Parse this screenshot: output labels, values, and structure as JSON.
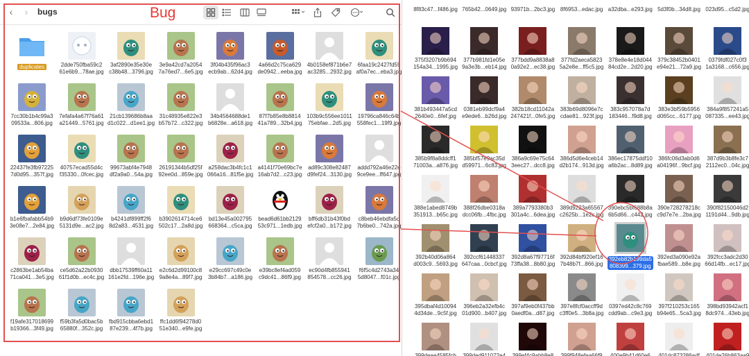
{
  "toolbar": {
    "back_icon": "chevron-left-icon",
    "forward_icon": "chevron-right-icon",
    "folder_title": "bugs",
    "annotation": "Bug"
  },
  "left_items": [
    {
      "name": "duplicates",
      "kind": "folder"
    },
    {
      "name": "2dde750fba59c2\n61e6b9...78ae.jpg",
      "kind": "ghost"
    },
    {
      "name": "3af2890e35e30e\nc38b48...3796.jpg",
      "kind": "teal"
    },
    {
      "name": "3e9a42cd7a2054\n7a76ed7...6e5.jpg",
      "kind": "green"
    },
    {
      "name": "3f04b435f96ac3\necb9ab...62d4.jpg",
      "kind": "purple"
    },
    {
      "name": "4a66d2c75ca629\nde0942...eeba.jpg",
      "kind": "purple2"
    },
    {
      "name": "4b0158ef871b6e7\nac3285...2932.jpg",
      "kind": "person"
    },
    {
      "name": "6faa19c2427fd59\naf0a7ec...eba3.jpg",
      "kind": "teal"
    },
    {
      "name": "7cc30b1b4c99a3\n09533a...806.jpg",
      "kind": "teal2"
    },
    {
      "name": "7efafa4a67f76a61\na21449...5761.jpg",
      "kind": "green"
    },
    {
      "name": "21cb139686b8aa\nd1c022...d1ee1.jpg",
      "kind": "teal3"
    },
    {
      "name": "31c48935e822e3\nb57b72...c322.jpg",
      "kind": "green"
    },
    {
      "name": "34b4564688de1\nb6828e...a618.jpg",
      "kind": "person"
    },
    {
      "name": "87f7b85e8b8814\n41a789...32b4.jpg",
      "kind": "green"
    },
    {
      "name": "103b9c556ee1011\n75ebfae...2d5.jpg",
      "kind": "teal"
    },
    {
      "name": "19796ca846c64b\n558fec1...19f9.jpg",
      "kind": "purple"
    },
    {
      "name": "22437fe3fb97225\n7d0d95...357f.jpg",
      "kind": "orange"
    },
    {
      "name": "40757ecad55d4c\nf35330...0fcec.jpg",
      "kind": "teal"
    },
    {
      "name": "99673abf4e7948\ndf2a9a0...54a.jpg",
      "kind": "green"
    },
    {
      "name": "26191344b5df25f\n92ee0d...859e.jpg",
      "kind": "green"
    },
    {
      "name": "a258dac3b4fc1c1\n066a16...81f5e.jpg",
      "kind": "magenta"
    },
    {
      "name": "a4141f70e69bc7e\n16ab7d2...c23.jpg",
      "kind": "green"
    },
    {
      "name": "ad89c308e82487\nd9fef24...3130.jpg",
      "kind": "purple"
    },
    {
      "name": "addd792a46e22e\n9ce9ee...ff647.jpg",
      "kind": "person"
    },
    {
      "name": "b1e6fbafabb54b9\n3e08e7...2e84.jpg",
      "kind": "orange"
    },
    {
      "name": "b9d6df73fe0109e\n5131d9e...ac2.jpg",
      "kind": "orange2"
    },
    {
      "name": "b4241df899ff2f6\n8d2a83...4531.jpg",
      "kind": "teal3"
    },
    {
      "name": "b3902614714ce6\n502c17...2a8d.jpg",
      "kind": "teal"
    },
    {
      "name": "bd13e45a002795\n668364...c5ca.jpg",
      "kind": "magenta"
    },
    {
      "name": "bead6d61bb2129\n53c971...1edb.jpg",
      "kind": "penguin"
    },
    {
      "name": "bff6db31b43f0bd\nefcf2a0...b172.jpg",
      "kind": "magenta"
    },
    {
      "name": "c8beb46ebdfa5d\n7b6be0...742a.jpg",
      "kind": "purple"
    },
    {
      "name": "c2863be1ab54ba\n71ca041...3e5.jpg",
      "kind": "magenta"
    },
    {
      "name": "ce5d62a22b0930\n61f1d0b...ec4c.jpg",
      "kind": "green"
    },
    {
      "name": "dbb17539ff60a11\n161e2fd...196e.jpg",
      "kind": "person"
    },
    {
      "name": "e2c6d2d99100c8\n9a8e4a...89f7.jpg",
      "kind": "orange2"
    },
    {
      "name": "e29cc697c49c0e\n3b84b7...a186.jpg",
      "kind": "teal3"
    },
    {
      "name": "e39bc8ef4ad059\nc9dc41...86f9.jpg",
      "kind": "green"
    },
    {
      "name": "ec90d4fb855941\n854578...cc26.jpg",
      "kind": "person"
    },
    {
      "name": "f6f5c4d2743a34\n5d8047...f01c.jpg",
      "kind": "green2"
    },
    {
      "name": "f19afe317018699\nb19366...3f49.jpg",
      "kind": "green"
    },
    {
      "name": "f59b3fa5d0bac5b\n65880f...352c.jpg",
      "kind": "teal3"
    },
    {
      "name": "fbd915cbba6ebd1\n87e239...4f7b.jpg",
      "kind": "teal3"
    },
    {
      "name": "ffc1dd6f94278d0\n51e340...e9fe.jpg",
      "kind": "orange2"
    }
  ],
  "right_items": [
    {
      "name": "8f83c47...f486.jpg",
      "color": "#ffffff"
    },
    {
      "name": "765b42...0649.jpg",
      "color": "#ffffff"
    },
    {
      "name": "93971b...2bc3.jpg",
      "color": "#ffffff"
    },
    {
      "name": "8f6953...edac.jpg",
      "color": "#ffffff"
    },
    {
      "name": "a32dba...e293.jpg",
      "color": "#ffffff"
    },
    {
      "name": "5d3f0b...34d8.jpg",
      "color": "#ffffff"
    },
    {
      "name": "023d95...c5d2.jpg",
      "color": "#ffffff"
    },
    {
      "name": "375f3207b9b694\n154a34...1995.jpg",
      "color": "#2a1f4a"
    },
    {
      "name": "377b981fd1e05e\n9a3e3b...eb14.jpg",
      "color": "#3b2a2a"
    },
    {
      "name": "377bdd9a8838a8\n0a92e2...ec38.jpg",
      "color": "#7a1f1f"
    },
    {
      "name": "377fd2aeca5823\n5a2e8e...ff5c5.jpg",
      "color": "#8a7a6a"
    },
    {
      "name": "378e8e4e18d044\n84cd2e...2d20.jpg",
      "color": "#1a1a1a"
    },
    {
      "name": "379c38452b0401\ne94e21...72a9.jpg",
      "color": "#5a4a3a"
    },
    {
      "name": "0379fdf027c0f3\n1a3168...c656.jpg",
      "color": "#2a4a8a"
    },
    {
      "name": "381b493447a5cd\n2640e0...6fef.jpg",
      "color": "#6a5aaa"
    },
    {
      "name": "0381eb99dcf9a4\ne9ede6...b26d.jpg",
      "color": "#3a2a2a"
    },
    {
      "name": "382b18cd11042a\n247421f...0fe5.jpg",
      "color": "#b08a6a"
    },
    {
      "name": "383b69d8096e7c\ncdae81...923f.jpg",
      "color": "#c0b0a0"
    },
    {
      "name": "383c957078a7d\n183446...f9d8.jpg",
      "color": "#3a3030"
    },
    {
      "name": "383e3bf59b5956\nd065cc...6177.jpg",
      "color": "#5a4020"
    },
    {
      "name": "384a9f857241a5\n087335...ee43.jpg",
      "color": "#e0e0e0"
    },
    {
      "name": "385b9f8a8ddcff1\n71003a...a876.jpg",
      "color": "#2a2a2a"
    },
    {
      "name": "385bf57e9ac35d\nd59971...6c83.jpg",
      "color": "#d0c030"
    },
    {
      "name": "386a9c69e75c64\n3eec27...dcc8.jpg",
      "color": "#111111"
    },
    {
      "name": "386d5d6e4ceb14\nd2b174...913d.jpg",
      "color": "#d0a090"
    },
    {
      "name": "386ec17875ddf10\na6b2ac...8d89.jpg",
      "color": "#506070"
    },
    {
      "name": "386fc06d3ab0d6\na04196f...9bcf.jpg",
      "color": "#e8a0c0"
    },
    {
      "name": "387d9b3b8fe3c7\n2112ec0...04c.jpg",
      "color": "#8a7050"
    },
    {
      "name": "388e1abed8749b\n351913...b65c.jpg",
      "color": "#f0f0f0"
    },
    {
      "name": "388f26dbe0318a\ndcc06fb...4fbc.jpg",
      "color": "#c08070"
    },
    {
      "name": "389a7793380b3\n301a4c...6dea.jpg",
      "color": "#b03030"
    },
    {
      "name": "389d9223a65567\nc2625b...1e2c.jpg",
      "color": "#dddddd"
    },
    {
      "name": "390ebc5bf688b8a\n6b5d66...c442.jpg",
      "color": "#2a2a2a"
    },
    {
      "name": "390e728278218c\nc9d7e7e...2ba.jpg",
      "color": "#7a6050"
    },
    {
      "name": "390f82150046d2\n1191d44...9db.jpg",
      "color": "#3a3a3a"
    },
    {
      "name": "392b40d06a864\nd003c9...5693.jpg",
      "color": "#a09070"
    },
    {
      "name": "392ccf61448337\n647caa...0cbcf.jpg",
      "color": "#304050"
    },
    {
      "name": "392d8a67f97716f\n73ffa38...8b80.jpg",
      "color": "#3050a0"
    },
    {
      "name": "392d84bf920ef16\n7b48b7f...866.jpg",
      "color": "#d0b080"
    },
    {
      "name": "392eb82b199da5\n808399...379.jpg",
      "color": "#5a8a90",
      "selected": true
    },
    {
      "name": "392ed3a090e92a\nfbae589...b8e.jpg",
      "color": "#c09090"
    },
    {
      "name": "392fcc3adc2d30\n66d14fb...ec17.jpg",
      "color": "#d0c0c0"
    },
    {
      "name": "395dbaf4d10094\n4d34de...9c5f.jpg",
      "color": "#c0a080"
    },
    {
      "name": "396eb2a32efb4c\n01d900...b407.jpg",
      "color": "#d0c0b0"
    },
    {
      "name": "397af9eb0f437bb\n0aedf0a...d87.jpg",
      "color": "#7a5a40"
    },
    {
      "name": "397e8fcf0accff9d\nc3ff0e5...3b8a.jpg",
      "color": "#8a8a8a"
    },
    {
      "name": "0397ed42c8c769\ncdd9ab...c9e3.jpg",
      "color": "#f0f0f0"
    },
    {
      "name": "397f210253c165\nb94e65...5ca3.jpg",
      "color": "#d0c8c0"
    },
    {
      "name": "398bd93942acf1\n8dc974...43eb.jpg",
      "color": "#d07080"
    },
    {
      "name": "399deae4585fcb",
      "color": "#b09080"
    },
    {
      "name": "399ded911072e4",
      "color": "#e0e0e0"
    },
    {
      "name": "399ef4c9abb8e8",
      "color": "#200808"
    },
    {
      "name": "399f948efea66f9",
      "color": "#d0a090"
    },
    {
      "name": "400e9b41d60e6",
      "color": "#c04040"
    },
    {
      "name": "401dc873286adf",
      "color": "#eeeeee"
    },
    {
      "name": "401de26b863aa9",
      "color": "#c02020"
    }
  ]
}
